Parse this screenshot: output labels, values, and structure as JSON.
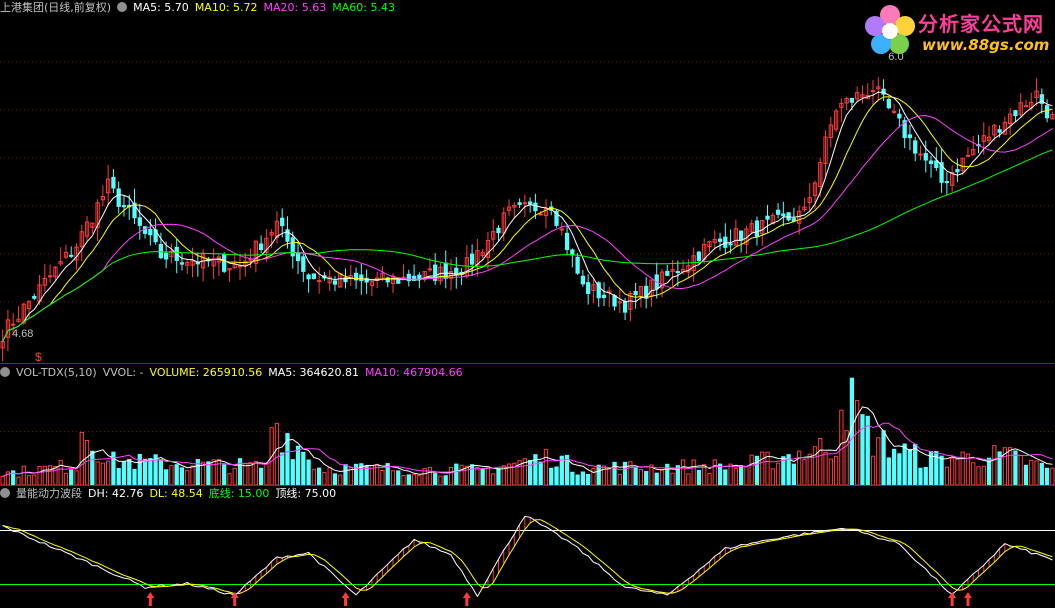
{
  "colors": {
    "bg": "#000000",
    "up": "#ff3b3b",
    "down": "#54ffff",
    "ma5": "#ffffff",
    "ma10": "#ffff00",
    "ma20": "#ff40ff",
    "ma60": "#00ff00",
    "grid": "#7a1010",
    "divider": "#b01010",
    "label": "#c0c0c0",
    "vol_label": "#ffff00",
    "dh": "#ffffff",
    "dl": "#ffff00",
    "floor_line": "#00ff00",
    "top_line": "#ffffff"
  },
  "main_panel": {
    "title": "上港集团(日线,前复权)",
    "ma5": "MA5: 5.70",
    "ma10": "MA10: 5.72",
    "ma20": "MA20: 5.63",
    "ma60": "MA60: 5.43",
    "high_label": "6.0",
    "low_label": "4.68",
    "signal_marker": "$"
  },
  "volume_panel": {
    "title": "VOL-TDX(5,10)",
    "vvol": "VVOL: -",
    "volume": "VOLUME: 265910.56",
    "ma5": "MA5: 364620.81",
    "ma10": "MA10: 467904.66"
  },
  "indicator_panel": {
    "title": "量能动力波段",
    "dh": "DH: 42.76",
    "dl": "DL: 48.54",
    "floor": "底线: 15.00",
    "top": "顶线: 75.00"
  },
  "watermark": {
    "site_name": "分析家公式网",
    "site_url": "www.88gs.com"
  },
  "chart_data": [
    {
      "type": "candlestick",
      "title": "上港集团(日线,前复权)",
      "x_count": 200,
      "ylim": [
        4.6,
        6.2
      ],
      "price_anchors": [
        [
          0,
          4.68
        ],
        [
          14,
          5.1
        ],
        [
          20,
          5.38
        ],
        [
          30,
          5.05
        ],
        [
          45,
          5.0
        ],
        [
          52,
          5.2
        ],
        [
          58,
          4.95
        ],
        [
          68,
          4.92
        ],
        [
          80,
          4.95
        ],
        [
          88,
          5.0
        ],
        [
          96,
          5.25
        ],
        [
          104,
          5.3
        ],
        [
          110,
          4.9
        ],
        [
          118,
          4.82
        ],
        [
          126,
          4.95
        ],
        [
          134,
          5.1
        ],
        [
          142,
          5.17
        ],
        [
          152,
          5.25
        ],
        [
          158,
          5.75
        ],
        [
          165,
          5.85
        ],
        [
          172,
          5.6
        ],
        [
          178,
          5.4
        ],
        [
          184,
          5.55
        ],
        [
          190,
          5.7
        ],
        [
          196,
          5.82
        ],
        [
          199,
          5.7
        ]
      ],
      "high_value": 6.0,
      "low_value": 4.68,
      "series": [
        {
          "name": "MA5",
          "value": 5.7
        },
        {
          "name": "MA10",
          "value": 5.72
        },
        {
          "name": "MA20",
          "value": 5.63
        },
        {
          "name": "MA60",
          "value": 5.43
        }
      ]
    },
    {
      "type": "bar",
      "title": "VOL-TDX(5,10)",
      "x_count": 200,
      "volume_anchors": [
        [
          0,
          200000
        ],
        [
          14,
          350000
        ],
        [
          15,
          1050000
        ],
        [
          20,
          420000
        ],
        [
          50,
          320000
        ],
        [
          51,
          1150000
        ],
        [
          60,
          300000
        ],
        [
          90,
          260000
        ],
        [
          105,
          520000
        ],
        [
          108,
          300000
        ],
        [
          140,
          340000
        ],
        [
          158,
          700000
        ],
        [
          159,
          1700000
        ],
        [
          165,
          800000
        ],
        [
          175,
          450000
        ],
        [
          190,
          520000
        ],
        [
          199,
          265910
        ]
      ],
      "ylim": [
        0,
        1800000
      ],
      "series": [
        {
          "name": "VOLUME",
          "value": 265910.56
        },
        {
          "name": "MA5",
          "value": 364620.81
        },
        {
          "name": "MA10",
          "value": 467904.66
        }
      ]
    },
    {
      "type": "line",
      "title": "量能动力波段",
      "x_count": 200,
      "ylim": [
        0,
        100
      ],
      "dh_anchors": [
        [
          0,
          80
        ],
        [
          8,
          60
        ],
        [
          18,
          35
        ],
        [
          27,
          12
        ],
        [
          35,
          16
        ],
        [
          44,
          3
        ],
        [
          52,
          45
        ],
        [
          58,
          50
        ],
        [
          67,
          3
        ],
        [
          78,
          65
        ],
        [
          85,
          48
        ],
        [
          90,
          3
        ],
        [
          99,
          92
        ],
        [
          108,
          60
        ],
        [
          118,
          12
        ],
        [
          126,
          3
        ],
        [
          137,
          55
        ],
        [
          148,
          68
        ],
        [
          160,
          78
        ],
        [
          170,
          60
        ],
        [
          180,
          3
        ],
        [
          190,
          60
        ],
        [
          199,
          42.76
        ]
      ],
      "series": [
        {
          "name": "DH",
          "value": 42.76
        },
        {
          "name": "DL",
          "value": 48.54
        }
      ],
      "reference_lines": [
        {
          "name": "底线",
          "value": 15.0
        },
        {
          "name": "顶线",
          "value": 75.0
        }
      ],
      "buy_signals": [
        28,
        44,
        65,
        88,
        180,
        183
      ]
    }
  ]
}
